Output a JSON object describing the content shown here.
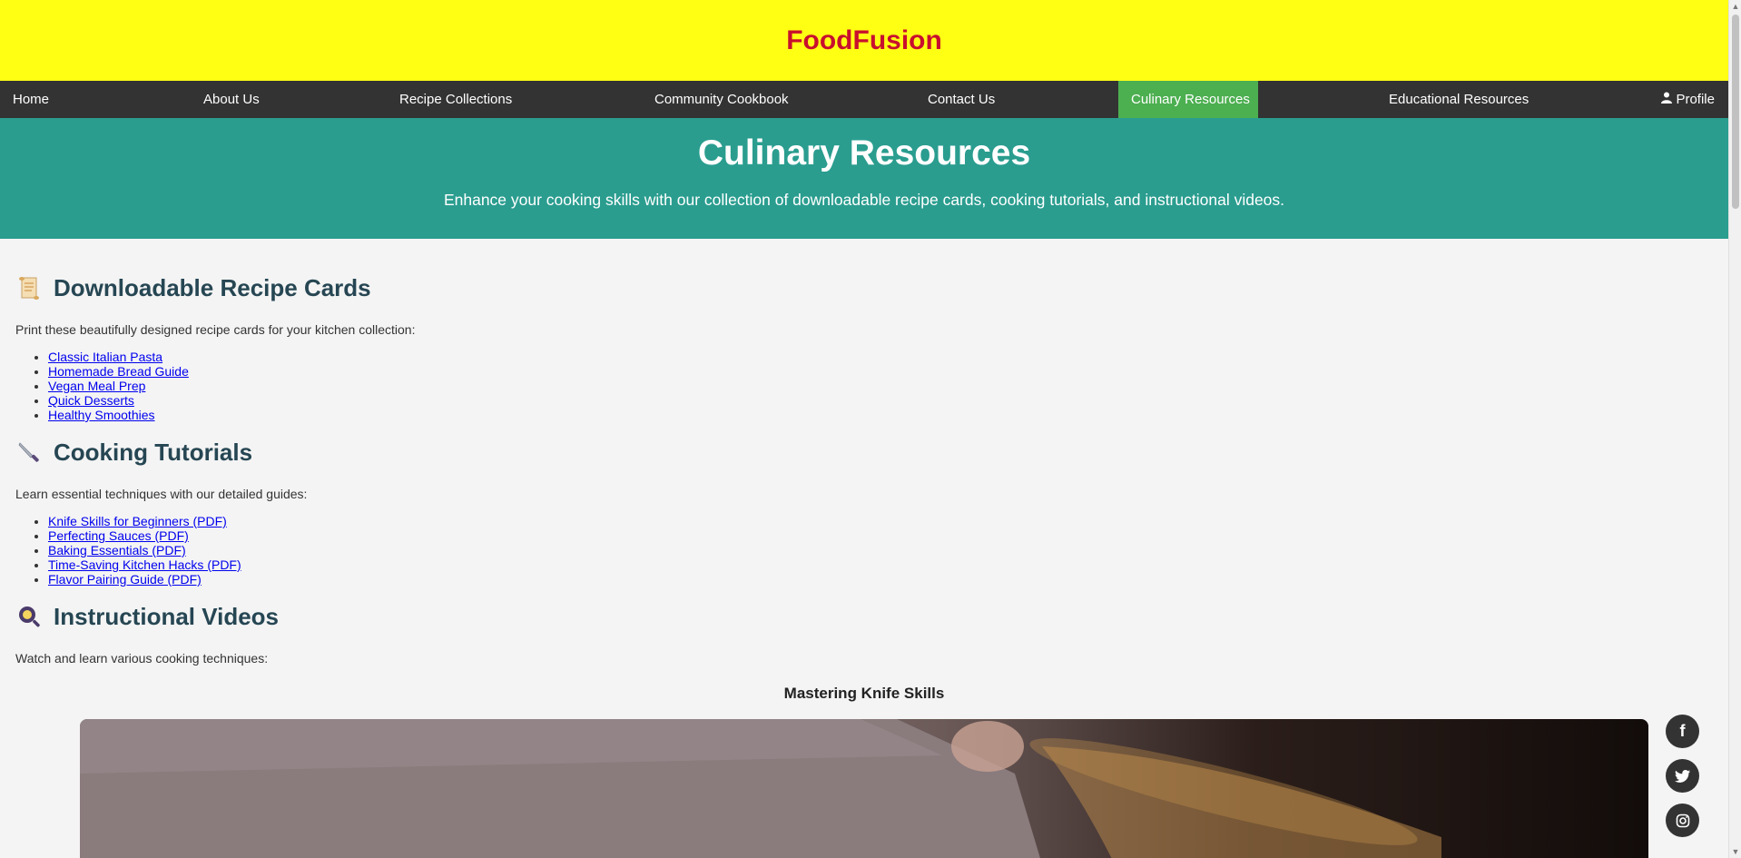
{
  "site": {
    "title": "FoodFusion"
  },
  "nav": {
    "items": [
      {
        "label": "Home"
      },
      {
        "label": "About Us"
      },
      {
        "label": "Recipe Collections"
      },
      {
        "label": "Community Cookbook"
      },
      {
        "label": "Contact Us"
      },
      {
        "label": "Culinary Resources",
        "active": true
      },
      {
        "label": "Educational Resources"
      }
    ],
    "profile_label": "Profile",
    "profile_icon": "user-icon",
    "active_color": "#4caf50"
  },
  "hero": {
    "title": "Culinary Resources",
    "subtitle": "Enhance your cooking skills with our collection of downloadable recipe cards, cooking tutorials, and instructional videos."
  },
  "sections": {
    "recipe_cards": {
      "icon": "scroll-icon",
      "heading": "Downloadable Recipe Cards",
      "desc": "Print these beautifully designed recipe cards for your kitchen collection:",
      "links": [
        "Classic Italian Pasta",
        "Homemade Bread Guide",
        "Vegan Meal Prep",
        "Quick Desserts",
        "Healthy Smoothies"
      ]
    },
    "tutorials": {
      "icon": "knife-icon",
      "heading": "Cooking Tutorials",
      "desc": "Learn essential techniques with our detailed guides:",
      "links": [
        "Knife Skills for Beginners (PDF)",
        "Perfecting Sauces (PDF)",
        "Baking Essentials (PDF)",
        "Time-Saving Kitchen Hacks (PDF)",
        "Flavor Pairing Guide (PDF)"
      ]
    },
    "videos": {
      "icon": "frying-pan-icon",
      "heading": "Instructional Videos",
      "desc": "Watch and learn various cooking techniques:",
      "video_title": "Mastering Knife Skills"
    }
  },
  "social": [
    {
      "icon": "facebook-icon",
      "glyph": "f"
    },
    {
      "icon": "twitter-icon",
      "glyph": "🐦"
    },
    {
      "icon": "instagram-icon",
      "glyph": "◎"
    }
  ],
  "colors": {
    "header_bg": "#ffff14",
    "brand": "#c8102e",
    "nav_bg": "#333333",
    "hero_bg": "#2a9d8f",
    "heading": "#264653"
  }
}
